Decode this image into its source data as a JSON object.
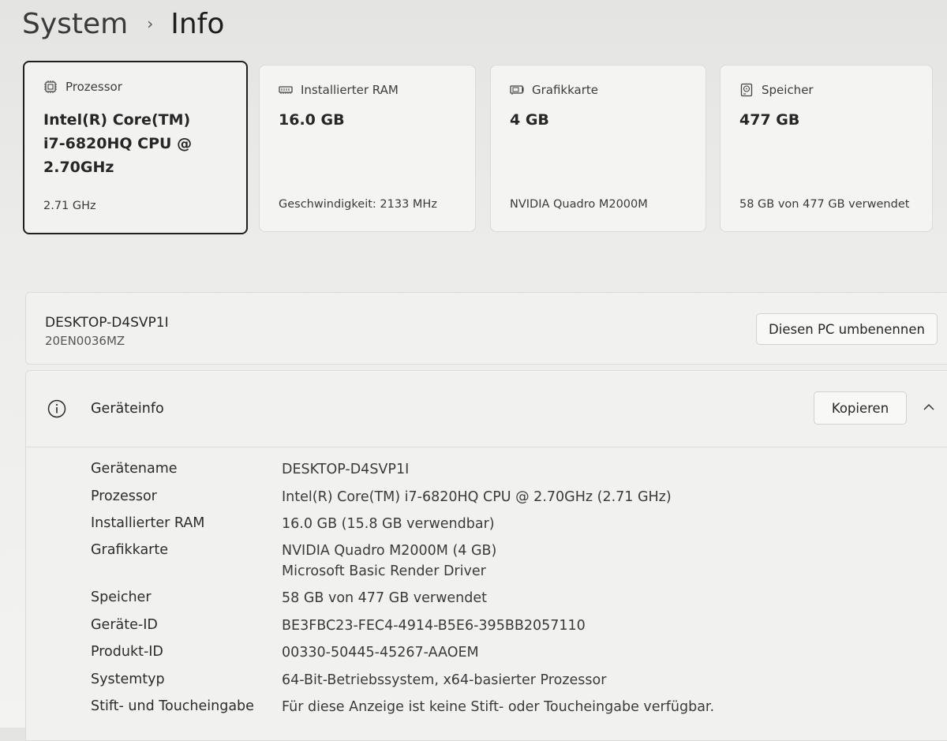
{
  "breadcrumb": {
    "parent": "System",
    "separator": "›",
    "current": "Info"
  },
  "cards": [
    {
      "icon": "processor-chip-icon",
      "label": "Prozessor",
      "value_lines": [
        "Intel(R) Core(TM)",
        "i7-6820HQ CPU @",
        "2.70GHz"
      ],
      "footer": "2.71 GHz",
      "selected": true
    },
    {
      "icon": "ram-module-icon",
      "label": "Installierter RAM",
      "value_lines": [
        "16.0 GB"
      ],
      "footer": "Geschwindigkeit: 2133 MHz",
      "selected": false
    },
    {
      "icon": "graphics-card-icon",
      "label": "Grafikkarte",
      "value_lines": [
        "4 GB"
      ],
      "footer": "NVIDIA Quadro M2000M",
      "selected": false
    },
    {
      "icon": "storage-drive-icon",
      "label": "Speicher",
      "value_lines": [
        "477 GB"
      ],
      "footer": "58 GB von 477 GB verwendet",
      "selected": false
    }
  ],
  "device": {
    "name": "DESKTOP-D4SVP1I",
    "model": "20EN0036MZ",
    "rename_button": "Diesen PC umbenennen"
  },
  "device_info": {
    "icon": "info-circle-icon",
    "title": "Geräteinfo",
    "copy_button": "Kopieren",
    "collapse_icon": "chevron-up-icon",
    "rows": [
      {
        "label": "Gerätename",
        "value": [
          "DESKTOP-D4SVP1I"
        ]
      },
      {
        "label": "Prozessor",
        "value": [
          "Intel(R) Core(TM) i7-6820HQ CPU @ 2.70GHz (2.71 GHz)"
        ]
      },
      {
        "label": "Installierter RAM",
        "value": [
          "16.0 GB (15.8 GB verwendbar)"
        ]
      },
      {
        "label": "Grafikkarte",
        "value": [
          "NVIDIA Quadro M2000M (4 GB)",
          "Microsoft Basic Render Driver"
        ]
      },
      {
        "label": "Speicher",
        "value": [
          "58 GB von 477 GB verwendet"
        ]
      },
      {
        "label": "Geräte-ID",
        "value": [
          "BE3FBC23-FEC4-4914-B5E6-395BB2057110"
        ]
      },
      {
        "label": "Produkt-ID",
        "value": [
          "00330-50445-45267-AAOEM"
        ]
      },
      {
        "label": "Systemtyp",
        "value": [
          "64-Bit-Betriebssystem, x64-basierter Prozessor"
        ]
      },
      {
        "label": "Stift- und Toucheingabe",
        "value": [
          "Für diese Anzeige ist keine Stift- oder Toucheingabe verfügbar."
        ]
      }
    ]
  }
}
